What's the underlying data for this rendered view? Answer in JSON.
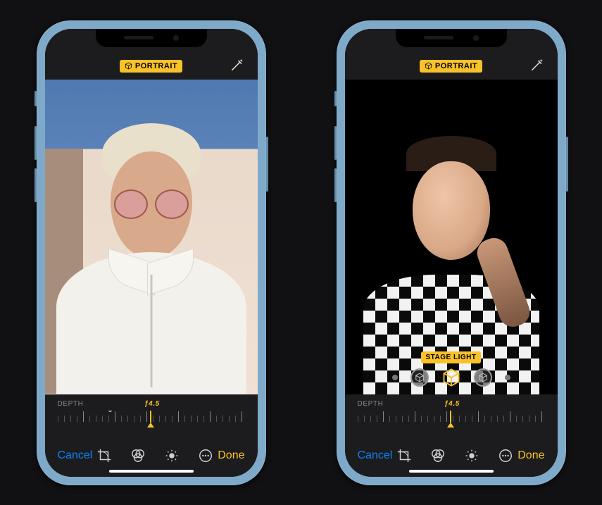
{
  "colors": {
    "accent": "#f9c229",
    "cancel": "#0a84ff",
    "panel": "#1c1c1e"
  },
  "phone1": {
    "badge": "PORTRAIT",
    "depth_label": "DEPTH",
    "depth_value": "ƒ4.5",
    "cancel": "Cancel",
    "done": "Done"
  },
  "phone2": {
    "badge": "PORTRAIT",
    "light_mode": "STAGE LIGHT",
    "depth_label": "DEPTH",
    "depth_value": "ƒ4.5",
    "cancel": "Cancel",
    "done": "Done"
  }
}
